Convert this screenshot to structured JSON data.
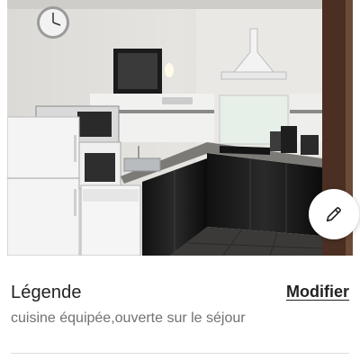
{
  "photo": {
    "subject": "kitchen-photo"
  },
  "edit_button": {
    "icon": "pencil-icon"
  },
  "caption": {
    "label": "Légende",
    "modify_label": "Modifier",
    "text": "cuisine équipée,ouverte sur le séjour"
  }
}
